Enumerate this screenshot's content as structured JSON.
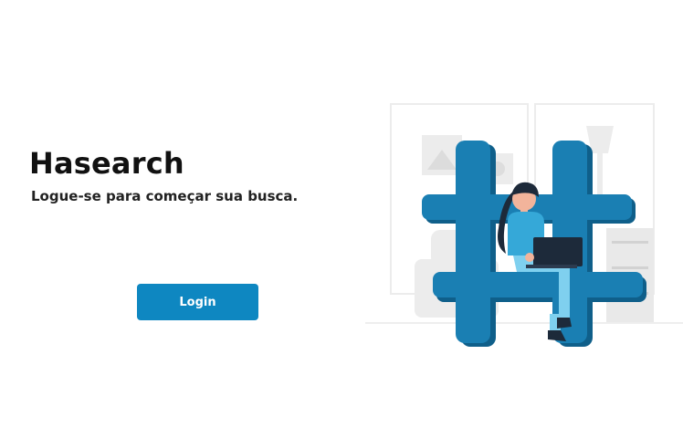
{
  "brand": {
    "title": "Hasearch",
    "tagline": "Logue-se para começar sua busca."
  },
  "actions": {
    "login_label": "Login"
  },
  "illustration": {
    "icon": "hashtag-icon",
    "description_icon": "person-with-laptop-icon"
  },
  "colors": {
    "accent": "#0e87c1",
    "hashtag": "#1a7fb3",
    "hashtag_shadow": "#0f5f8a",
    "background_furniture": "#ececec"
  }
}
